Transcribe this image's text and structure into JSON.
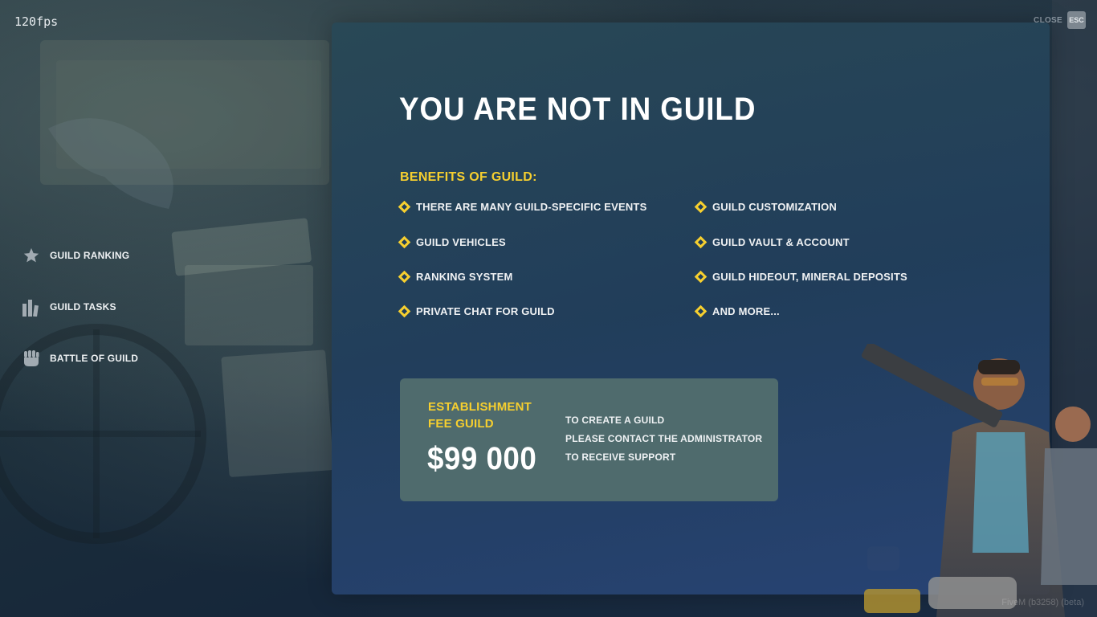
{
  "fps": "120fps",
  "close": {
    "label": "CLOSE",
    "key": "ESC"
  },
  "sidebar": {
    "items": [
      {
        "label": "GUILD RANKING",
        "icon": "star-icon"
      },
      {
        "label": "GUILD TASKS",
        "icon": "bars-icon"
      },
      {
        "label": "BATTLE OF GUILD",
        "icon": "fist-icon"
      }
    ]
  },
  "main": {
    "title": "YOU ARE NOT IN GUILD",
    "benefits_heading": "BENEFITS OF GUILD:",
    "benefits": [
      "THERE ARE MANY GUILD-SPECIFIC EVENTS",
      "GUILD CUSTOMIZATION",
      "GUILD VEHICLES",
      "GUILD VAULT & ACCOUNT",
      "RANKING SYSTEM",
      "GUILD HIDEOUT, MINERAL DEPOSITS",
      "PRIVATE CHAT FOR GUILD",
      "AND MORE..."
    ],
    "fee": {
      "title": "ESTABLISHMENT FEE GUILD",
      "price": "$99 000",
      "info": [
        "TO CREATE A GUILD",
        "PLEASE CONTACT THE ADMINISTRATOR",
        "TO RECEIVE SUPPORT"
      ]
    }
  },
  "version": "FiveM (b3258) (beta)",
  "colors": {
    "accent": "#f6cf2f",
    "panel": "#27445e",
    "fee_card": "#4f6b6d",
    "text": "#f0f2f4"
  }
}
